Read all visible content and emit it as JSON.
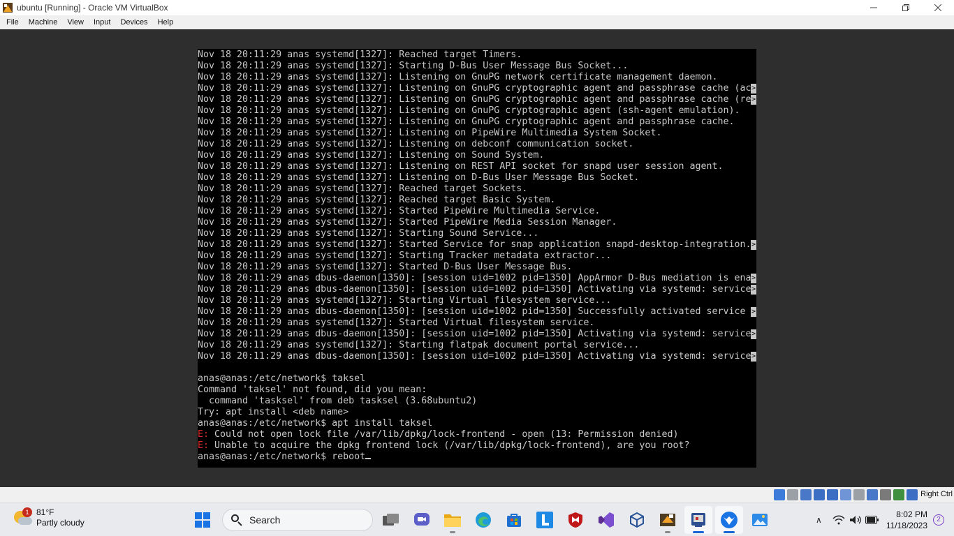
{
  "window": {
    "title": "ubuntu [Running] - Oracle VM VirtualBox",
    "controls": [
      "minimize",
      "restore",
      "close"
    ]
  },
  "menubar": {
    "items": [
      "File",
      "Machine",
      "View",
      "Input",
      "Devices",
      "Help"
    ]
  },
  "terminal": {
    "lines": [
      {
        "text": "Nov 18 20:11:29 anas systemd[1327]: Reached target Timers.",
        "trunc": false
      },
      {
        "text": "Nov 18 20:11:29 anas systemd[1327]: Starting D-Bus User Message Bus Socket...",
        "trunc": false
      },
      {
        "text": "Nov 18 20:11:29 anas systemd[1327]: Listening on GnuPG network certificate management daemon.",
        "trunc": false
      },
      {
        "text": "Nov 18 20:11:29 anas systemd[1327]: Listening on GnuPG cryptographic agent and passphrase cache (ac",
        "trunc": true
      },
      {
        "text": "Nov 18 20:11:29 anas systemd[1327]: Listening on GnuPG cryptographic agent and passphrase cache (re",
        "trunc": true
      },
      {
        "text": "Nov 18 20:11:29 anas systemd[1327]: Listening on GnuPG cryptographic agent (ssh-agent emulation).",
        "trunc": false
      },
      {
        "text": "Nov 18 20:11:29 anas systemd[1327]: Listening on GnuPG cryptographic agent and passphrase cache.",
        "trunc": false
      },
      {
        "text": "Nov 18 20:11:29 anas systemd[1327]: Listening on PipeWire Multimedia System Socket.",
        "trunc": false
      },
      {
        "text": "Nov 18 20:11:29 anas systemd[1327]: Listening on debconf communication socket.",
        "trunc": false
      },
      {
        "text": "Nov 18 20:11:29 anas systemd[1327]: Listening on Sound System.",
        "trunc": false
      },
      {
        "text": "Nov 18 20:11:29 anas systemd[1327]: Listening on REST API socket for snapd user session agent.",
        "trunc": false
      },
      {
        "text": "Nov 18 20:11:29 anas systemd[1327]: Listening on D-Bus User Message Bus Socket.",
        "trunc": false
      },
      {
        "text": "Nov 18 20:11:29 anas systemd[1327]: Reached target Sockets.",
        "trunc": false
      },
      {
        "text": "Nov 18 20:11:29 anas systemd[1327]: Reached target Basic System.",
        "trunc": false
      },
      {
        "text": "Nov 18 20:11:29 anas systemd[1327]: Started PipeWire Multimedia Service.",
        "trunc": false
      },
      {
        "text": "Nov 18 20:11:29 anas systemd[1327]: Started PipeWire Media Session Manager.",
        "trunc": false
      },
      {
        "text": "Nov 18 20:11:29 anas systemd[1327]: Starting Sound Service...",
        "trunc": false
      },
      {
        "text": "Nov 18 20:11:29 anas systemd[1327]: Started Service for snap application snapd-desktop-integration.",
        "trunc": true
      },
      {
        "text": "Nov 18 20:11:29 anas systemd[1327]: Starting Tracker metadata extractor...",
        "trunc": false
      },
      {
        "text": "Nov 18 20:11:29 anas systemd[1327]: Started D-Bus User Message Bus.",
        "trunc": false
      },
      {
        "text": "Nov 18 20:11:29 anas dbus-daemon[1350]: [session uid=1002 pid=1350] AppArmor D-Bus mediation is ena",
        "trunc": true
      },
      {
        "text": "Nov 18 20:11:29 anas dbus-daemon[1350]: [session uid=1002 pid=1350] Activating via systemd: service",
        "trunc": true
      },
      {
        "text": "Nov 18 20:11:29 anas systemd[1327]: Starting Virtual filesystem service...",
        "trunc": false
      },
      {
        "text": "Nov 18 20:11:29 anas dbus-daemon[1350]: [session uid=1002 pid=1350] Successfully activated service ",
        "trunc": true
      },
      {
        "text": "Nov 18 20:11:29 anas systemd[1327]: Started Virtual filesystem service.",
        "trunc": false
      },
      {
        "text": "Nov 18 20:11:29 anas dbus-daemon[1350]: [session uid=1002 pid=1350] Activating via systemd: service",
        "trunc": true
      },
      {
        "text": "Nov 18 20:11:29 anas systemd[1327]: Starting flatpak document portal service...",
        "trunc": false
      },
      {
        "text": "Nov 18 20:11:29 anas dbus-daemon[1350]: [session uid=1002 pid=1350] Activating via systemd: service",
        "trunc": true
      },
      {
        "text": "",
        "trunc": false
      },
      {
        "text": "anas@anas:/etc/network$ taksel",
        "trunc": false
      },
      {
        "text": "Command 'taksel' not found, did you mean:",
        "trunc": false
      },
      {
        "text": "  command 'tasksel' from deb tasksel (3.68ubuntu2)",
        "trunc": false
      },
      {
        "text": "Try: apt install <deb name>",
        "trunc": false
      },
      {
        "text": "anas@anas:/etc/network$ apt install taksel",
        "trunc": false
      },
      {
        "text": " Could not open lock file /var/lib/dpkg/lock-frontend - open (13: Permission denied)",
        "trunc": false,
        "err_prefix": "E:"
      },
      {
        "text": " Unable to acquire the dpkg frontend lock (/var/lib/dpkg/lock-frontend), are you root?",
        "trunc": false,
        "err_prefix": "E:"
      },
      {
        "text": "anas@anas:/etc/network$ reboot",
        "trunc": false,
        "cursor": true
      }
    ]
  },
  "vbox_status": {
    "host_key": "Right Ctrl",
    "icons": [
      "hard-disk-icon",
      "optical-drive-icon",
      "audio-icon",
      "network-icon",
      "usb-icon",
      "shared-folders-icon",
      "display-icon",
      "recording-icon",
      "cpu-icon",
      "mouse-integration-icon",
      "keyboard-icon"
    ]
  },
  "taskbar": {
    "weather": {
      "temp": "81°F",
      "condition": "Partly cloudy",
      "badge": "1"
    },
    "search_label": "Search",
    "apps": [
      "start-icon",
      "task-view-icon",
      "chat-icon",
      "file-explorer-icon",
      "edge-icon",
      "store-icon",
      "l-app-icon",
      "mcafee-icon",
      "visual-studio-icon",
      "virtualbox-cube-icon",
      "sublime-icon",
      "virtualbox-manager-icon",
      "virtualbox-vm-icon",
      "paint-icon"
    ],
    "clock": {
      "time": "8:02 PM",
      "date": "11/18/2023"
    },
    "notifications": "2",
    "colors": {
      "accent": "#1a66d2",
      "error": "#d42a2a"
    }
  }
}
